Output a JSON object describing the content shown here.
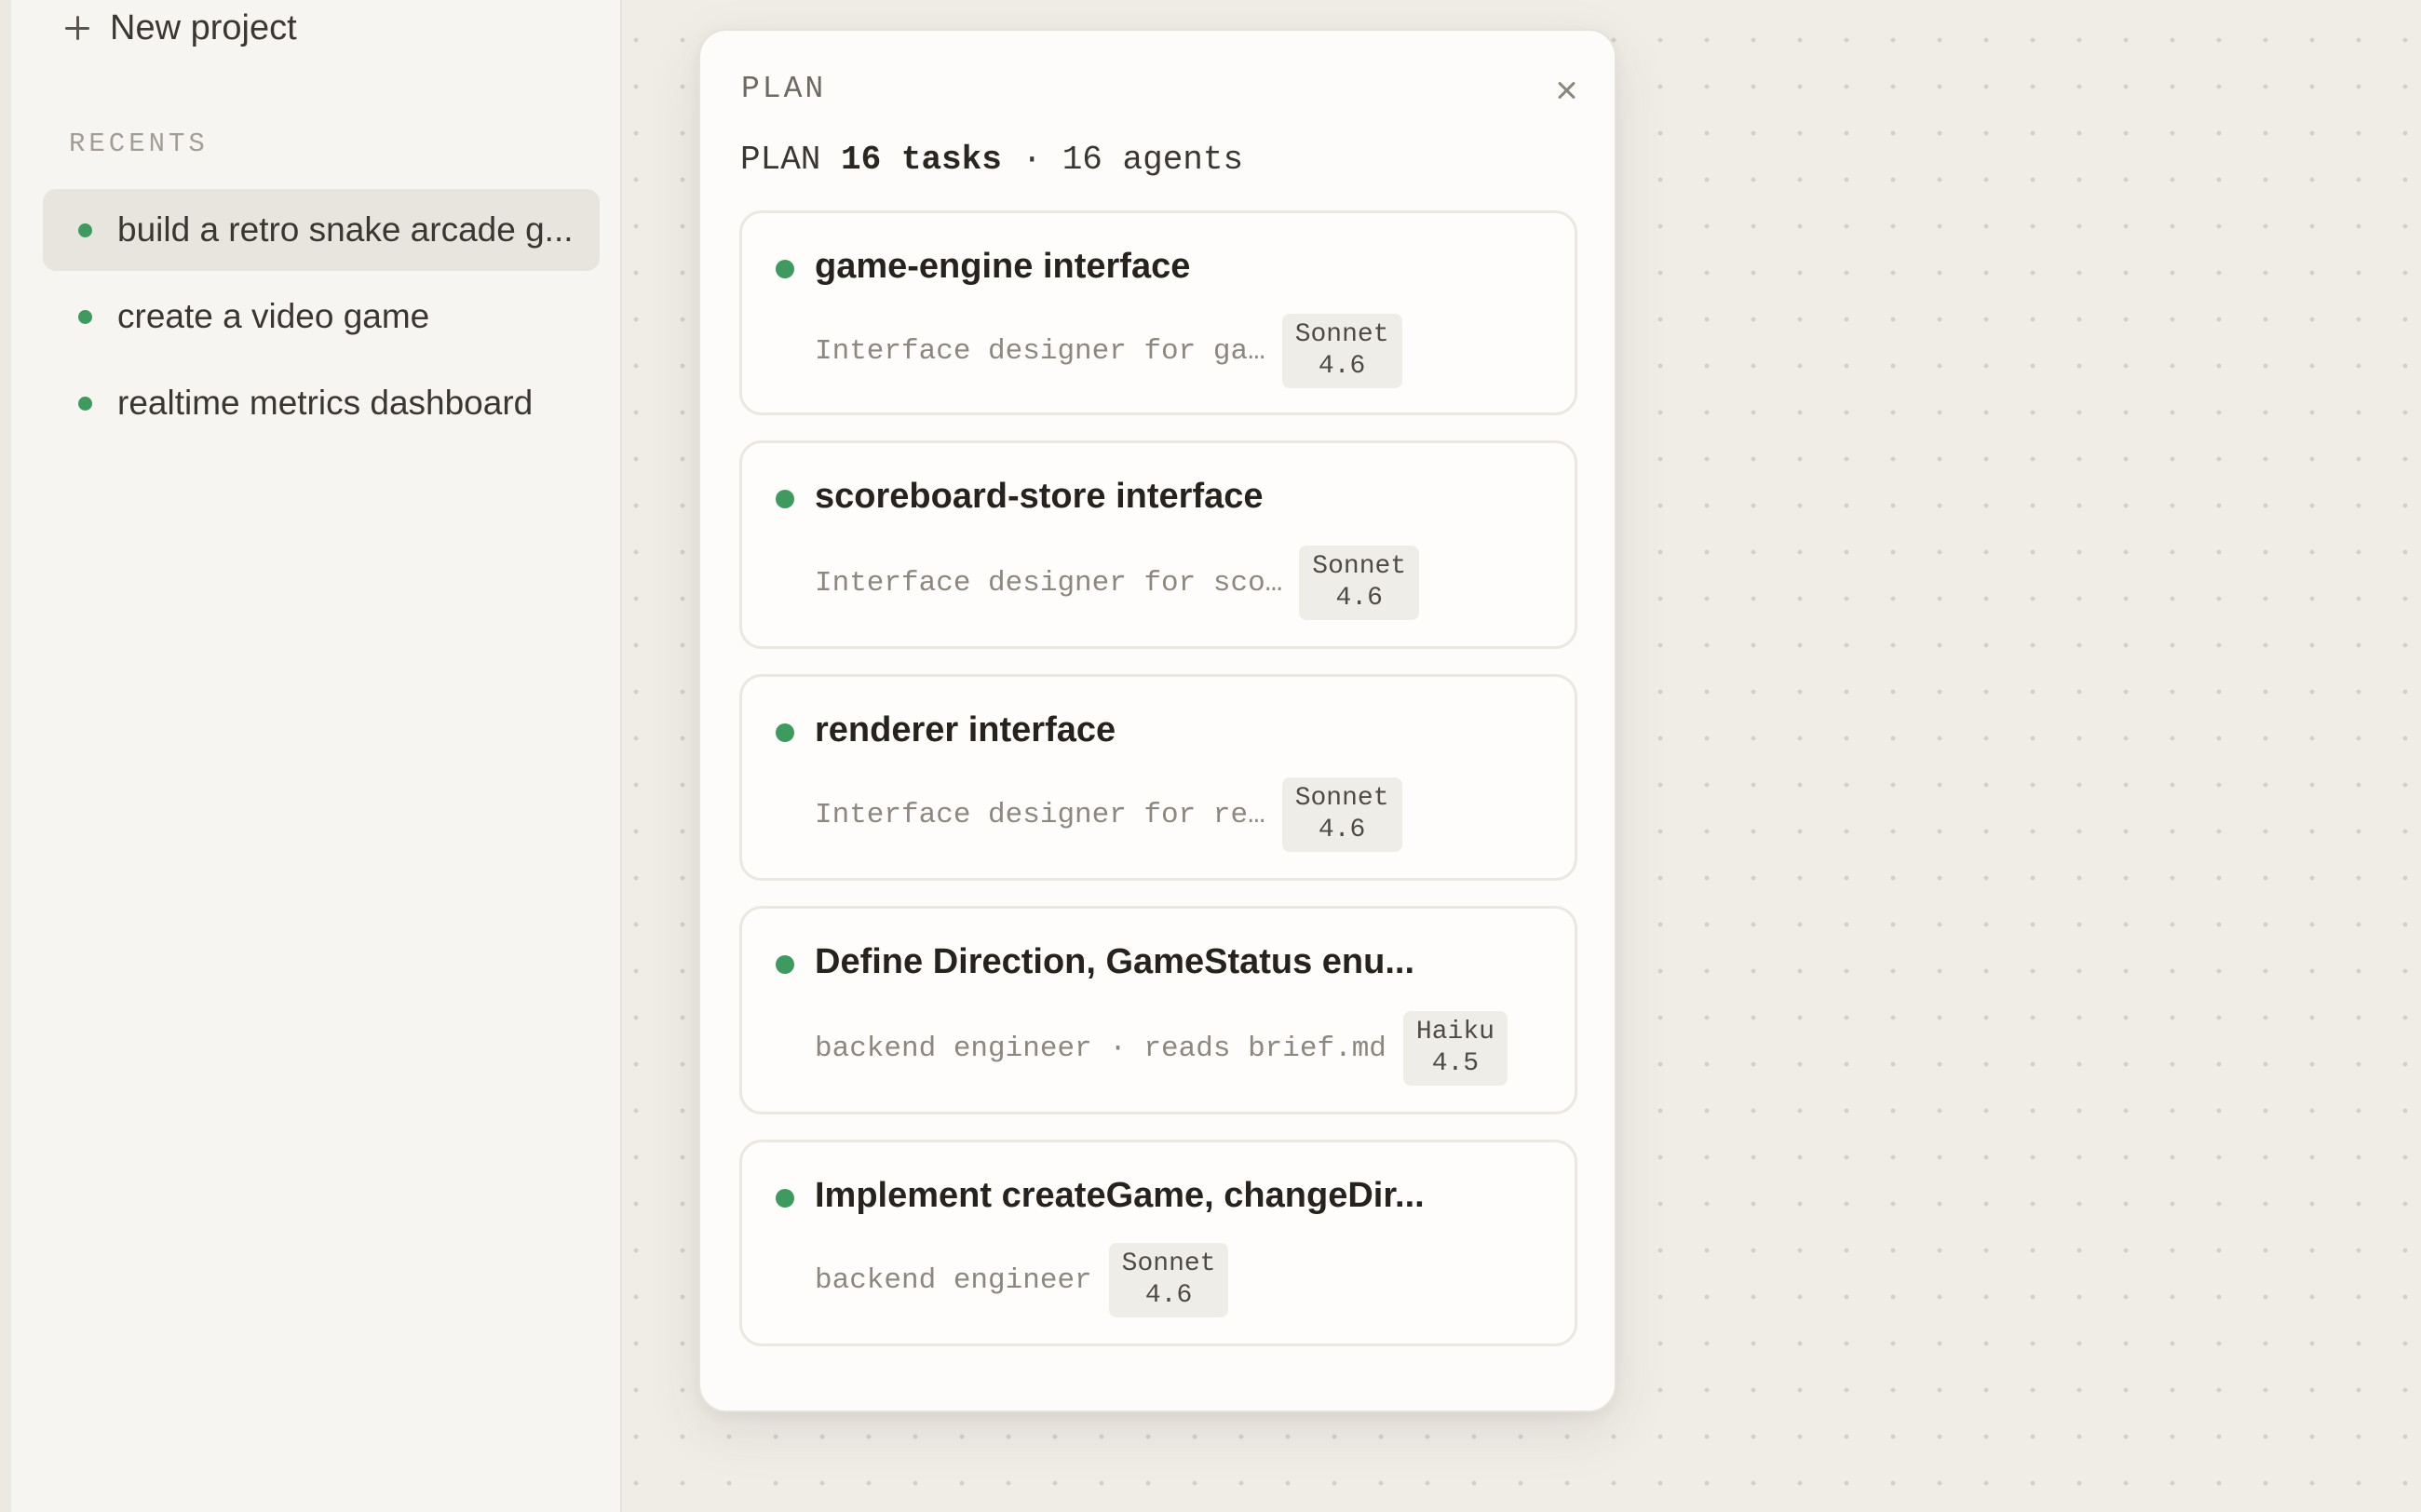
{
  "sidebar": {
    "new_project_label": "New project",
    "recents_heading": "RECENTS",
    "recents": [
      {
        "label": "build a retro snake arcade g...",
        "active": true
      },
      {
        "label": "create a video game",
        "active": false
      },
      {
        "label": "realtime metrics dashboard",
        "active": false
      }
    ]
  },
  "panel": {
    "title": "PLAN",
    "summary_prefix": "PLAN",
    "summary_tasks": "16 tasks",
    "summary_separator": "·",
    "summary_agents": "16 agents",
    "tasks": [
      {
        "title": "game-engine interface",
        "description": "Interface designer for ga…",
        "model_line1": "Sonnet",
        "model_line2": "4.6"
      },
      {
        "title": "scoreboard-store interface",
        "description": "Interface designer for sco…",
        "model_line1": "Sonnet",
        "model_line2": "4.6"
      },
      {
        "title": "renderer interface",
        "description": "Interface designer for re…",
        "model_line1": "Sonnet",
        "model_line2": "4.6"
      },
      {
        "title": "Define Direction, GameStatus enu...",
        "description": "backend engineer · reads brief.md",
        "model_line1": "Haiku",
        "model_line2": "4.5"
      },
      {
        "title": "Implement createGame, changeDir...",
        "description": "backend engineer",
        "model_line1": "Sonnet",
        "model_line2": "4.6"
      }
    ]
  },
  "colors": {
    "status_dot": "#3f9a60",
    "canvas_bg": "#f0ede7",
    "panel_bg": "#fdfcfa"
  }
}
